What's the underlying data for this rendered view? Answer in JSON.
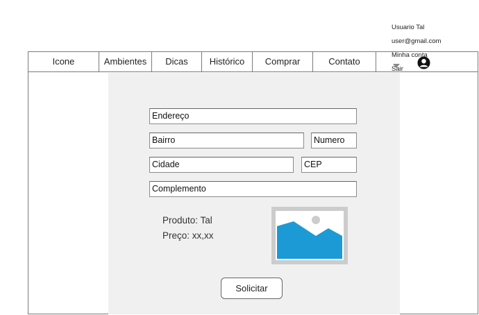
{
  "nav": {
    "items": [
      {
        "label": "Icone"
      },
      {
        "label": "Ambientes"
      },
      {
        "label": "Dicas"
      },
      {
        "label": "Histórico"
      },
      {
        "label": "Comprar"
      },
      {
        "label": "Contato"
      }
    ]
  },
  "user_menu": {
    "name": "Usuario Tal",
    "email": "user@gmail.com",
    "account": "Minha conta",
    "logout": "Sair"
  },
  "form": {
    "address": "Endereço",
    "neighborhood": "Bairro",
    "number": "Numero",
    "city": "Cidade",
    "zip": "CEP",
    "complement": "Complemento"
  },
  "product": {
    "name": "Produto: Tal",
    "price": "Preço: xx,xx"
  },
  "actions": {
    "submit": "Solicitar"
  },
  "icons": {
    "dropdown": "chevron-down-icon",
    "user": "user-avatar-icon",
    "image": "image-placeholder-icon"
  },
  "colors": {
    "content_bg": "#f0f0f0",
    "image_frame": "#cccccc",
    "image_mountain": "#1b9ad6"
  }
}
